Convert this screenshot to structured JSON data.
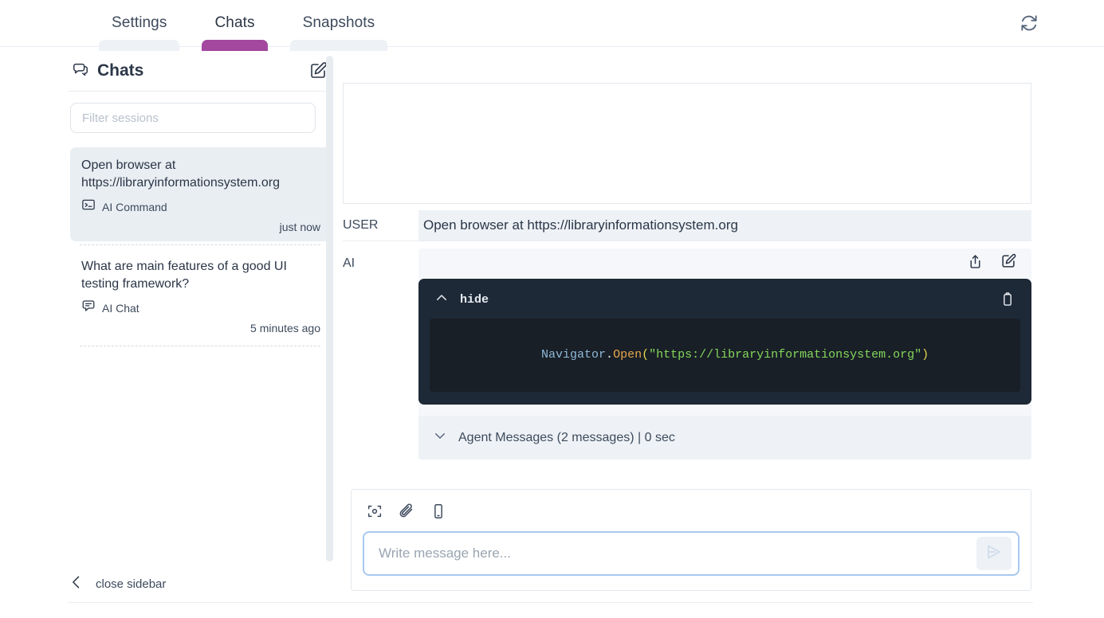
{
  "header": {
    "tabs": [
      {
        "label": "Settings",
        "active": false
      },
      {
        "label": "Chats",
        "active": true
      },
      {
        "label": "Snapshots",
        "active": false
      }
    ],
    "refresh_icon": "refresh-icon"
  },
  "sidebar": {
    "title": "Chats",
    "title_icon": "chat-bubble-icon",
    "new_chat_icon": "edit-square-icon",
    "filter": {
      "placeholder": "Filter sessions",
      "value": ""
    },
    "sessions": [
      {
        "title": "Open browser at https://libraryinformationsystem.org",
        "kind": "AI Command",
        "kind_icon": "terminal-icon",
        "time": "just now",
        "selected": true
      },
      {
        "title": "What are main features of a good UI testing framework?",
        "kind": "AI Chat",
        "kind_icon": "speech-bubble-icon",
        "time": "5 minutes ago",
        "selected": false
      }
    ],
    "close_label": "close sidebar",
    "close_icon": "chevron-left-icon"
  },
  "conversation": {
    "user": {
      "role": "USER",
      "text": "Open browser at https://libraryinformationsystem.org"
    },
    "ai": {
      "role": "AI",
      "share_icon": "share-icon",
      "edit_icon": "edit-square-icon",
      "code": {
        "toggle_label": "hide",
        "toggle_icon": "chevron-up-icon",
        "copy_icon": "clipboard-icon",
        "tokens": [
          {
            "text": "Navigator",
            "type": "obj"
          },
          {
            "text": ".",
            "type": "dot"
          },
          {
            "text": "Open",
            "type": "fn"
          },
          {
            "text": "(",
            "type": "paren"
          },
          {
            "text": "\"https://libraryinformationsystem.org\"",
            "type": "str"
          },
          {
            "text": ")",
            "type": "paren"
          }
        ],
        "plain": "Navigator.Open(\"https://libraryinformationsystem.org\")"
      },
      "agent_messages": {
        "label": "Agent Messages (2 messages) | 0 sec",
        "toggle_icon": "chevron-down-icon"
      }
    }
  },
  "composer": {
    "tools": [
      {
        "icon": "screenshot-icon",
        "name": "capture-screenshot"
      },
      {
        "icon": "paperclip-icon",
        "name": "attach-file"
      },
      {
        "icon": "mobile-device-icon",
        "name": "select-device"
      }
    ],
    "input": {
      "placeholder": "Write message here...",
      "value": ""
    },
    "send_icon": "send-icon"
  },
  "colors": {
    "accent": "#a4479f",
    "code_bg": "#1e2937",
    "code_inner_bg": "#191f27",
    "focus_border": "#a8c8ef",
    "selected_row": "#e9eef3"
  }
}
